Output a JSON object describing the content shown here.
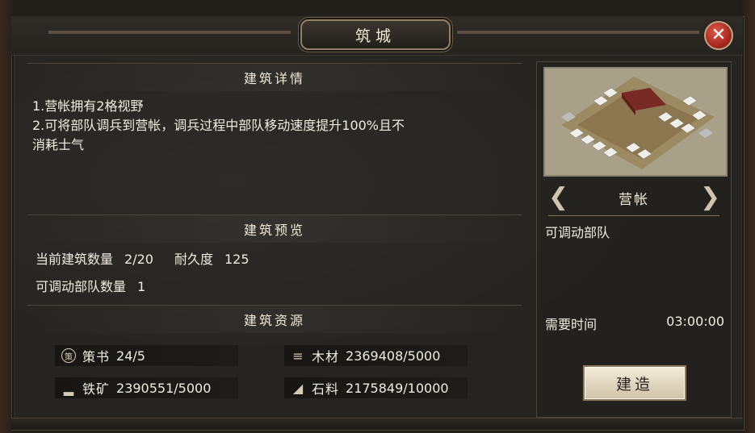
{
  "dialog": {
    "title": "筑城",
    "close_glyph": "✕"
  },
  "details": {
    "heading": "建筑详情",
    "lines": [
      "1.营帐拥有2格视野",
      "2.可将部队调兵到营帐，调兵过程中部队移动速度提升100%且不",
      "消耗士气"
    ]
  },
  "preview": {
    "heading": "建筑预览",
    "count_label": "当前建筑数量",
    "count_value": "2/20",
    "durability_label": "耐久度",
    "durability_value": "125",
    "troops_label": "可调动部队数量",
    "troops_value": "1"
  },
  "resources": {
    "heading": "建筑资源",
    "items": [
      {
        "icon": "strategy-book-icon",
        "glyph": "策",
        "label": "策书",
        "value": "24/5"
      },
      {
        "icon": "wood-icon",
        "glyph": "≡",
        "label": "木材",
        "value": "2369408/5000"
      },
      {
        "icon": "iron-ore-icon",
        "glyph": "▂",
        "label": "铁矿",
        "value": "2390551/5000"
      },
      {
        "icon": "stone-icon",
        "glyph": "◢",
        "label": "石料",
        "value": "2175849/10000"
      }
    ]
  },
  "building": {
    "name": "营帐",
    "prev_glyph": "❮",
    "next_glyph": "❯",
    "effect": "可调动部队",
    "time_label": "需要时间",
    "time_value": "03:00:00",
    "build_label": "建造"
  },
  "colors": {
    "panel": "#262420",
    "accent": "#8f7f66",
    "close": "#9d2219",
    "button": "#f4ecdb"
  }
}
